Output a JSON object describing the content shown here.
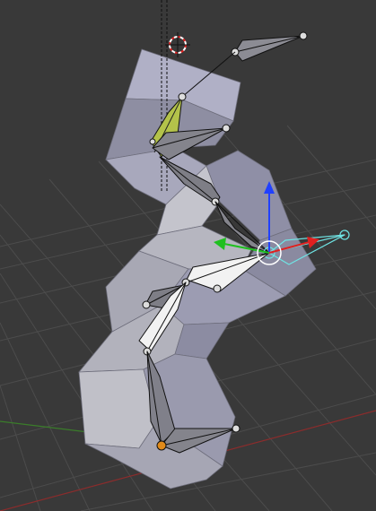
{
  "viewport": {
    "background": "#393939",
    "grid_color": "#4a4a4a",
    "x_axis_color": "#9b2f2f",
    "y_axis_color": "#3f8a2f"
  },
  "mesh": {
    "face_light": "#b4b4c8",
    "face_mid": "#9c9cb0",
    "face_dark": "#7a7a8e",
    "face_front": "#c8c8d0"
  },
  "armature": {
    "bone_fill": "#8a8a90",
    "bone_edge": "#111111",
    "active_bone_color": "#b3c24a",
    "selected_bone_fill": "#f0f0f0",
    "highlight_bone_color": "#6fe5e5"
  },
  "manipulator": {
    "x_color": "#e02020",
    "y_color": "#20c020",
    "z_color": "#2040ff"
  },
  "cursor_icon": "3d-cursor-icon"
}
